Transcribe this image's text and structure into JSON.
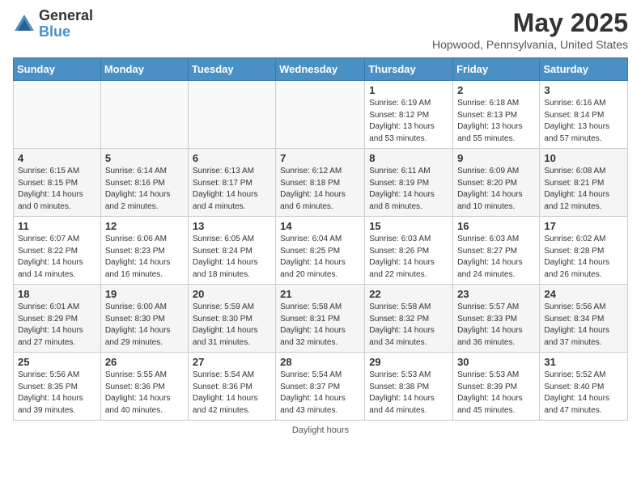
{
  "logo": {
    "line1": "General",
    "line2": "Blue"
  },
  "title": "May 2025",
  "subtitle": "Hopwood, Pennsylvania, United States",
  "days_header": [
    "Sunday",
    "Monday",
    "Tuesday",
    "Wednesday",
    "Thursday",
    "Friday",
    "Saturday"
  ],
  "weeks": [
    [
      {
        "day": "",
        "info": ""
      },
      {
        "day": "",
        "info": ""
      },
      {
        "day": "",
        "info": ""
      },
      {
        "day": "",
        "info": ""
      },
      {
        "day": "1",
        "info": "Sunrise: 6:19 AM\nSunset: 8:12 PM\nDaylight: 13 hours\nand 53 minutes."
      },
      {
        "day": "2",
        "info": "Sunrise: 6:18 AM\nSunset: 8:13 PM\nDaylight: 13 hours\nand 55 minutes."
      },
      {
        "day": "3",
        "info": "Sunrise: 6:16 AM\nSunset: 8:14 PM\nDaylight: 13 hours\nand 57 minutes."
      }
    ],
    [
      {
        "day": "4",
        "info": "Sunrise: 6:15 AM\nSunset: 8:15 PM\nDaylight: 14 hours\nand 0 minutes."
      },
      {
        "day": "5",
        "info": "Sunrise: 6:14 AM\nSunset: 8:16 PM\nDaylight: 14 hours\nand 2 minutes."
      },
      {
        "day": "6",
        "info": "Sunrise: 6:13 AM\nSunset: 8:17 PM\nDaylight: 14 hours\nand 4 minutes."
      },
      {
        "day": "7",
        "info": "Sunrise: 6:12 AM\nSunset: 8:18 PM\nDaylight: 14 hours\nand 6 minutes."
      },
      {
        "day": "8",
        "info": "Sunrise: 6:11 AM\nSunset: 8:19 PM\nDaylight: 14 hours\nand 8 minutes."
      },
      {
        "day": "9",
        "info": "Sunrise: 6:09 AM\nSunset: 8:20 PM\nDaylight: 14 hours\nand 10 minutes."
      },
      {
        "day": "10",
        "info": "Sunrise: 6:08 AM\nSunset: 8:21 PM\nDaylight: 14 hours\nand 12 minutes."
      }
    ],
    [
      {
        "day": "11",
        "info": "Sunrise: 6:07 AM\nSunset: 8:22 PM\nDaylight: 14 hours\nand 14 minutes."
      },
      {
        "day": "12",
        "info": "Sunrise: 6:06 AM\nSunset: 8:23 PM\nDaylight: 14 hours\nand 16 minutes."
      },
      {
        "day": "13",
        "info": "Sunrise: 6:05 AM\nSunset: 8:24 PM\nDaylight: 14 hours\nand 18 minutes."
      },
      {
        "day": "14",
        "info": "Sunrise: 6:04 AM\nSunset: 8:25 PM\nDaylight: 14 hours\nand 20 minutes."
      },
      {
        "day": "15",
        "info": "Sunrise: 6:03 AM\nSunset: 8:26 PM\nDaylight: 14 hours\nand 22 minutes."
      },
      {
        "day": "16",
        "info": "Sunrise: 6:03 AM\nSunset: 8:27 PM\nDaylight: 14 hours\nand 24 minutes."
      },
      {
        "day": "17",
        "info": "Sunrise: 6:02 AM\nSunset: 8:28 PM\nDaylight: 14 hours\nand 26 minutes."
      }
    ],
    [
      {
        "day": "18",
        "info": "Sunrise: 6:01 AM\nSunset: 8:29 PM\nDaylight: 14 hours\nand 27 minutes."
      },
      {
        "day": "19",
        "info": "Sunrise: 6:00 AM\nSunset: 8:30 PM\nDaylight: 14 hours\nand 29 minutes."
      },
      {
        "day": "20",
        "info": "Sunrise: 5:59 AM\nSunset: 8:30 PM\nDaylight: 14 hours\nand 31 minutes."
      },
      {
        "day": "21",
        "info": "Sunrise: 5:58 AM\nSunset: 8:31 PM\nDaylight: 14 hours\nand 32 minutes."
      },
      {
        "day": "22",
        "info": "Sunrise: 5:58 AM\nSunset: 8:32 PM\nDaylight: 14 hours\nand 34 minutes."
      },
      {
        "day": "23",
        "info": "Sunrise: 5:57 AM\nSunset: 8:33 PM\nDaylight: 14 hours\nand 36 minutes."
      },
      {
        "day": "24",
        "info": "Sunrise: 5:56 AM\nSunset: 8:34 PM\nDaylight: 14 hours\nand 37 minutes."
      }
    ],
    [
      {
        "day": "25",
        "info": "Sunrise: 5:56 AM\nSunset: 8:35 PM\nDaylight: 14 hours\nand 39 minutes."
      },
      {
        "day": "26",
        "info": "Sunrise: 5:55 AM\nSunset: 8:36 PM\nDaylight: 14 hours\nand 40 minutes."
      },
      {
        "day": "27",
        "info": "Sunrise: 5:54 AM\nSunset: 8:36 PM\nDaylight: 14 hours\nand 42 minutes."
      },
      {
        "day": "28",
        "info": "Sunrise: 5:54 AM\nSunset: 8:37 PM\nDaylight: 14 hours\nand 43 minutes."
      },
      {
        "day": "29",
        "info": "Sunrise: 5:53 AM\nSunset: 8:38 PM\nDaylight: 14 hours\nand 44 minutes."
      },
      {
        "day": "30",
        "info": "Sunrise: 5:53 AM\nSunset: 8:39 PM\nDaylight: 14 hours\nand 45 minutes."
      },
      {
        "day": "31",
        "info": "Sunrise: 5:52 AM\nSunset: 8:40 PM\nDaylight: 14 hours\nand 47 minutes."
      }
    ]
  ],
  "footer": "Daylight hours"
}
